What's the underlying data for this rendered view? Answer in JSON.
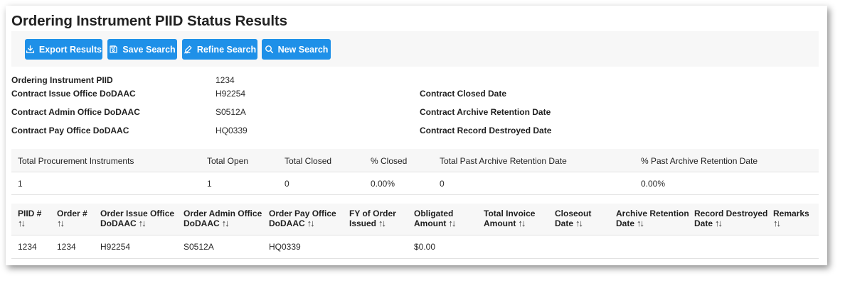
{
  "page": {
    "title": "Ordering Instrument PIID Status Results"
  },
  "toolbar": {
    "buttons": [
      {
        "label": "Export Results",
        "icon": "download-icon"
      },
      {
        "label": "Save Search",
        "icon": "save-icon"
      },
      {
        "label": "Refine Search",
        "icon": "edit-icon"
      },
      {
        "label": "New Search",
        "icon": "search-icon"
      }
    ],
    "accent_color": "#1e90e8"
  },
  "info": {
    "left": [
      {
        "label": "Ordering Instrument PIID",
        "value": "1234"
      },
      {
        "label": "Contract Issue Office DoDAAC",
        "value": "H92254"
      },
      {
        "label": "Contract Admin Office DoDAAC",
        "value": "S0512A"
      },
      {
        "label": "Contract Pay Office DoDAAC",
        "value": "HQ0339"
      }
    ],
    "right": [
      {
        "label": "Contract Closed Date",
        "value": ""
      },
      {
        "label": "Contract Archive Retention Date",
        "value": ""
      },
      {
        "label": "Contract Record Destroyed Date",
        "value": ""
      }
    ]
  },
  "summary": {
    "headers": [
      "Total Procurement Instruments",
      "Total Open",
      "Total Closed",
      "% Closed",
      "Total Past Archive Retention Date",
      "% Past Archive Retention Date"
    ],
    "row": [
      "1",
      "1",
      "0",
      "0.00%",
      "0",
      "0.00%"
    ]
  },
  "orders": {
    "headers": [
      [
        "PIID #",
        ""
      ],
      [
        "Order #",
        ""
      ],
      [
        "Order Issue Office",
        "DoDAAC"
      ],
      [
        "Order Admin Office",
        "DoDAAC"
      ],
      [
        "Order Pay Office",
        "DoDAAC"
      ],
      [
        "FY of Order",
        "Issued"
      ],
      [
        "Obligated",
        "Amount"
      ],
      [
        "Total Invoice",
        "Amount"
      ],
      [
        "Closeout",
        "Date"
      ],
      [
        "Archive Retention",
        "Date"
      ],
      [
        "Record Destroyed",
        "Date"
      ],
      [
        "Remarks",
        ""
      ]
    ],
    "sort_glyph": "↑↓",
    "rows": [
      [
        "1234",
        "1234",
        "H92254",
        "S0512A",
        "HQ0339",
        "",
        "$0.00",
        "",
        "",
        "",
        "",
        ""
      ]
    ]
  }
}
